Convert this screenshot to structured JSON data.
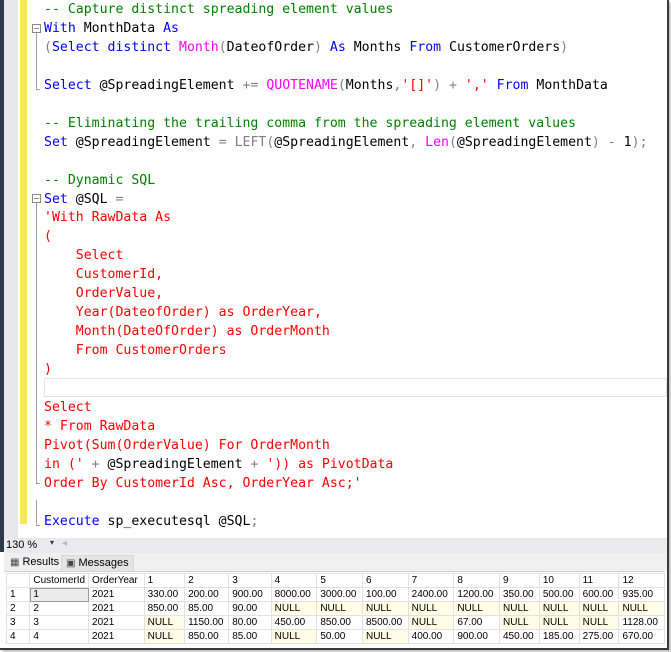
{
  "editor": {
    "lines": [
      {
        "tokens": [
          {
            "c": "cm",
            "t": "-- Capture distinct spreading element values"
          }
        ]
      },
      {
        "tokens": [
          {
            "c": "kw",
            "t": "With"
          },
          {
            "c": "tx",
            "t": " MonthData "
          },
          {
            "c": "kw",
            "t": "As"
          }
        ]
      },
      {
        "tokens": [
          {
            "c": "op",
            "t": "("
          },
          {
            "c": "kw",
            "t": "Select distinct "
          },
          {
            "c": "fn",
            "t": "Month"
          },
          {
            "c": "op",
            "t": "("
          },
          {
            "c": "tx",
            "t": "DateofOrder"
          },
          {
            "c": "op",
            "t": ")"
          },
          {
            "c": "kw",
            "t": " As"
          },
          {
            "c": "tx",
            "t": " Months "
          },
          {
            "c": "kw",
            "t": "From"
          },
          {
            "c": "tx",
            "t": " CustomerOrders"
          },
          {
            "c": "op",
            "t": ")"
          }
        ]
      },
      {
        "tokens": []
      },
      {
        "tokens": [
          {
            "c": "kw",
            "t": "Select"
          },
          {
            "c": "tx",
            "t": " @SpreadingElement "
          },
          {
            "c": "op",
            "t": "+="
          },
          {
            "c": "tx",
            "t": " "
          },
          {
            "c": "fn",
            "t": "QUOTENAME"
          },
          {
            "c": "op",
            "t": "("
          },
          {
            "c": "tx",
            "t": "Months"
          },
          {
            "c": "op",
            "t": ","
          },
          {
            "c": "str",
            "t": "'[]'"
          },
          {
            "c": "op",
            "t": ") + "
          },
          {
            "c": "str",
            "t": "','"
          },
          {
            "c": "tx",
            "t": " "
          },
          {
            "c": "kw",
            "t": "From"
          },
          {
            "c": "tx",
            "t": " MonthData"
          }
        ]
      },
      {
        "tokens": []
      },
      {
        "tokens": [
          {
            "c": "cm",
            "t": "-- Eliminating the trailing comma from the spreading element values"
          }
        ]
      },
      {
        "tokens": [
          {
            "c": "kw",
            "t": "Set"
          },
          {
            "c": "tx",
            "t": " @SpreadingElement "
          },
          {
            "c": "op",
            "t": "= LEFT("
          },
          {
            "c": "tx",
            "t": "@SpreadingElement"
          },
          {
            "c": "op",
            "t": ", "
          },
          {
            "c": "fn",
            "t": "Len"
          },
          {
            "c": "op",
            "t": "("
          },
          {
            "c": "tx",
            "t": "@SpreadingElement"
          },
          {
            "c": "op",
            "t": ") - "
          },
          {
            "c": "tx",
            "t": "1"
          },
          {
            "c": "op",
            "t": ");"
          }
        ]
      },
      {
        "tokens": []
      },
      {
        "tokens": [
          {
            "c": "cm",
            "t": "-- Dynamic SQL"
          }
        ]
      },
      {
        "tokens": [
          {
            "c": "kw",
            "t": "Set"
          },
          {
            "c": "tx",
            "t": " @SQL "
          },
          {
            "c": "op",
            "t": "="
          }
        ]
      },
      {
        "tokens": [
          {
            "c": "str",
            "t": "'With RawData As"
          }
        ]
      },
      {
        "tokens": [
          {
            "c": "str",
            "t": "("
          }
        ]
      },
      {
        "tokens": [
          {
            "c": "str",
            "t": "    Select"
          }
        ]
      },
      {
        "tokens": [
          {
            "c": "str",
            "t": "    CustomerId,"
          }
        ]
      },
      {
        "tokens": [
          {
            "c": "str",
            "t": "    OrderValue,"
          }
        ]
      },
      {
        "tokens": [
          {
            "c": "str",
            "t": "    Year(DateofOrder) as OrderYear,"
          }
        ]
      },
      {
        "tokens": [
          {
            "c": "str",
            "t": "    Month(DateOfOrder) as OrderMonth"
          }
        ]
      },
      {
        "tokens": [
          {
            "c": "str",
            "t": "    From CustomerOrders"
          }
        ]
      },
      {
        "tokens": [
          {
            "c": "str",
            "t": ")"
          }
        ]
      },
      {
        "tokens": []
      },
      {
        "tokens": [
          {
            "c": "str",
            "t": "Select"
          }
        ]
      },
      {
        "tokens": [
          {
            "c": "str",
            "t": "* From RawData"
          }
        ]
      },
      {
        "tokens": [
          {
            "c": "str",
            "t": "Pivot(Sum(OrderValue) For OrderMonth"
          }
        ]
      },
      {
        "tokens": [
          {
            "c": "str",
            "t": "in ('"
          },
          {
            "c": "op",
            "t": " + "
          },
          {
            "c": "tx",
            "t": "@SpreadingElement"
          },
          {
            "c": "op",
            "t": " + "
          },
          {
            "c": "str",
            "t": "')) as PivotData"
          }
        ]
      },
      {
        "tokens": [
          {
            "c": "str",
            "t": "Order By CustomerId Asc, OrderYear Asc;'"
          }
        ]
      },
      {
        "tokens": []
      },
      {
        "tokens": [
          {
            "c": "kw",
            "t": "Execute"
          },
          {
            "c": "tx",
            "t": " sp_executesql @SQL"
          },
          {
            "c": "op",
            "t": ";"
          }
        ]
      }
    ]
  },
  "zoom": {
    "value": "130 %",
    "arrow": "▾",
    "scroll_left": "◂"
  },
  "tabs": [
    {
      "label": "Results",
      "icon": "▦",
      "active": true
    },
    {
      "label": "Messages",
      "icon": "▣",
      "active": false
    }
  ],
  "results": {
    "columns": [
      "",
      "CustomerId",
      "OrderYear",
      "1",
      "2",
      "3",
      "4",
      "5",
      "6",
      "7",
      "8",
      "9",
      "10",
      "11",
      "12"
    ],
    "rows": [
      [
        "1",
        "1",
        "2021",
        "330.00",
        "200.00",
        "900.00",
        "8000.00",
        "3000.00",
        "100.00",
        "2400.00",
        "1200.00",
        "350.00",
        "500.00",
        "600.00",
        "935.00"
      ],
      [
        "2",
        "2",
        "2021",
        "850.00",
        "85.00",
        "90.00",
        "NULL",
        "NULL",
        "NULL",
        "NULL",
        "NULL",
        "NULL",
        "NULL",
        "NULL",
        "NULL"
      ],
      [
        "3",
        "3",
        "2021",
        "NULL",
        "1150.00",
        "80.00",
        "450.00",
        "850.00",
        "8500.00",
        "NULL",
        "67.00",
        "NULL",
        "NULL",
        "NULL",
        "1128.00"
      ],
      [
        "4",
        "4",
        "2021",
        "NULL",
        "850.00",
        "85.00",
        "NULL",
        "50.00",
        "NULL",
        "400.00",
        "900.00",
        "450.00",
        "185.00",
        "275.00",
        "670.00"
      ]
    ]
  }
}
